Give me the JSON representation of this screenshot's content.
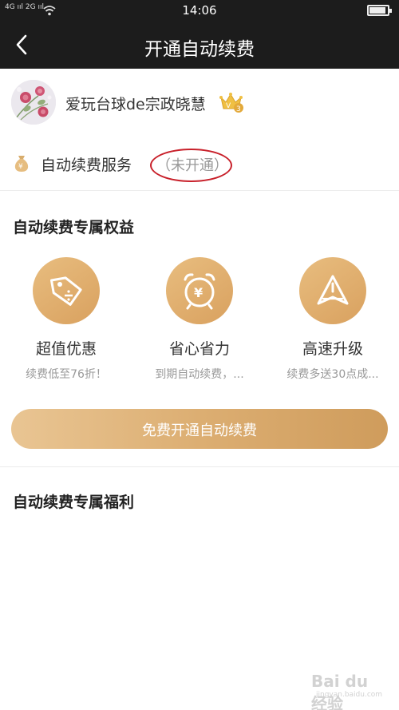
{
  "status_bar": {
    "signal": "4G ııl 2G ııl",
    "time": "14:06",
    "battery_level": 0.85,
    "icons": [
      "signal-icon",
      "wifi-icon",
      "battery-icon"
    ]
  },
  "navbar": {
    "title": "开通自动续费",
    "back_icon": "chevron-left-icon"
  },
  "profile": {
    "username": "爱玩台球de宗政晓慧",
    "vip_level": "3",
    "vip_letter": "V"
  },
  "service": {
    "icon": "money-bag-icon",
    "label": "自动续费服务",
    "status": "（未开通）"
  },
  "benefits_section": {
    "title": "自动续费专属权益",
    "items": [
      {
        "icon": "discount-tag-icon",
        "name": "超值优惠",
        "desc": "续费低至76折！"
      },
      {
        "icon": "alarm-clock-yen-icon",
        "name": "省心省力",
        "desc": "到期自动续费，..."
      },
      {
        "icon": "upgrade-arrow-icon",
        "name": "高速升级",
        "desc": "续费多送30点成..."
      }
    ]
  },
  "cta": {
    "label": "免费开通自动续费"
  },
  "welfare_section": {
    "title": "自动续费专属福利"
  },
  "watermark": {
    "text": "Bai du 经验",
    "sub": "jingyan.baidu.com"
  },
  "colors": {
    "nav_bg": "#1c1c1c",
    "gold": "#dcae72",
    "annotation_red": "#c8202a"
  }
}
